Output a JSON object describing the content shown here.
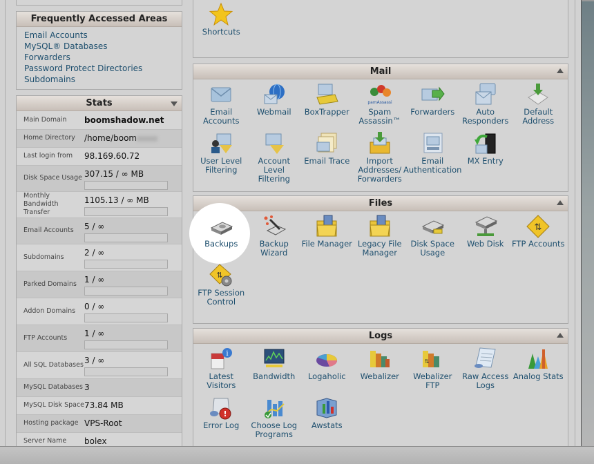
{
  "frequently_accessed": {
    "title": "Frequently Accessed Areas",
    "links": [
      "Email Accounts",
      "MySQL® Databases",
      "Forwarders",
      "Password Protect Directories",
      "Subdomains"
    ]
  },
  "stats": {
    "title": "Stats",
    "rows": [
      {
        "label": "Main Domain",
        "value": "boomshadow.net"
      },
      {
        "label": "Home Directory",
        "value": "/home/boom"
      },
      {
        "label": "Last login from",
        "value": "98.169.60.72"
      },
      {
        "label": "Disk Space Usage",
        "value": "307.15 / ∞ MB",
        "usage": 0
      },
      {
        "label": "Monthly Bandwidth Transfer",
        "value": "1105.13 / ∞ MB",
        "usage": 0
      },
      {
        "label": "Email Accounts",
        "value": "5 / ∞",
        "usage": 0
      },
      {
        "label": "Subdomains",
        "value": "2 / ∞",
        "usage": 0
      },
      {
        "label": "Parked Domains",
        "value": "1 / ∞",
        "usage": 0
      },
      {
        "label": "Addon Domains",
        "value": "0 / ∞",
        "usage": 0
      },
      {
        "label": "FTP Accounts",
        "value": "1 / ∞",
        "usage": 0
      },
      {
        "label": "All SQL Databases",
        "value": "3 / ∞",
        "usage": 0
      },
      {
        "label": "MySQL Databases",
        "value": "3"
      },
      {
        "label": "MySQL Disk Space",
        "value": "73.84 MB"
      },
      {
        "label": "Hosting package",
        "value": "VPS-Root"
      },
      {
        "label": "Server Name",
        "value": "bolex"
      }
    ]
  },
  "shortcuts": {
    "label": "Shortcuts"
  },
  "mail": {
    "title": "Mail",
    "items": [
      {
        "label": "Email Accounts",
        "icon": "envelope-icon"
      },
      {
        "label": "Webmail",
        "icon": "globe-envelope-icon"
      },
      {
        "label": "BoxTrapper",
        "icon": "trap-envelope-icon"
      },
      {
        "label": "Spam Assassin™",
        "icon": "spamassassin-icon"
      },
      {
        "label": "Forwarders",
        "icon": "forward-envelope-icon"
      },
      {
        "label": "Auto Responders",
        "icon": "auto-responder-icon"
      },
      {
        "label": "Default Address",
        "icon": "default-address-icon"
      },
      {
        "label": "User Level Filtering",
        "icon": "user-filter-icon"
      },
      {
        "label": "Account Level Filtering",
        "icon": "account-filter-icon"
      },
      {
        "label": "Email Trace",
        "icon": "email-trace-icon"
      },
      {
        "label": "Import Addresses/ Forwarders",
        "icon": "import-icon"
      },
      {
        "label": "Email Authentication",
        "icon": "email-auth-icon"
      },
      {
        "label": "MX Entry",
        "icon": "mx-entry-icon"
      }
    ]
  },
  "files": {
    "title": "Files",
    "items": [
      {
        "label": "Backups",
        "icon": "hard-drive-icon"
      },
      {
        "label": "Backup Wizard",
        "icon": "backup-wizard-icon"
      },
      {
        "label": "File Manager",
        "icon": "folder-icon"
      },
      {
        "label": "Legacy File Manager",
        "icon": "legacy-folder-icon"
      },
      {
        "label": "Disk Space Usage",
        "icon": "disk-usage-icon"
      },
      {
        "label": "Web Disk",
        "icon": "web-disk-icon"
      },
      {
        "label": "FTP Accounts",
        "icon": "ftp-icon"
      },
      {
        "label": "FTP Session Control",
        "icon": "ftp-session-icon"
      }
    ]
  },
  "logs": {
    "title": "Logs",
    "items": [
      {
        "label": "Latest Visitors",
        "icon": "latest-visitors-icon"
      },
      {
        "label": "Bandwidth",
        "icon": "bandwidth-icon"
      },
      {
        "label": "Logaholic",
        "icon": "pie-chart-icon"
      },
      {
        "label": "Webalizer",
        "icon": "webalizer-icon"
      },
      {
        "label": "Webalizer FTP",
        "icon": "webalizer-ftp-icon"
      },
      {
        "label": "Raw Access Logs",
        "icon": "raw-logs-icon"
      },
      {
        "label": "Analog Stats",
        "icon": "analog-stats-icon"
      },
      {
        "label": "Error Log",
        "icon": "error-log-icon"
      },
      {
        "label": "Choose Log Programs",
        "icon": "choose-log-icon"
      },
      {
        "label": "Awstats",
        "icon": "awstats-icon"
      }
    ]
  },
  "colors": {
    "link": "#1e4f6e",
    "header_bg": "#d8d0c9",
    "panel_bg": "#d4d4d4"
  }
}
